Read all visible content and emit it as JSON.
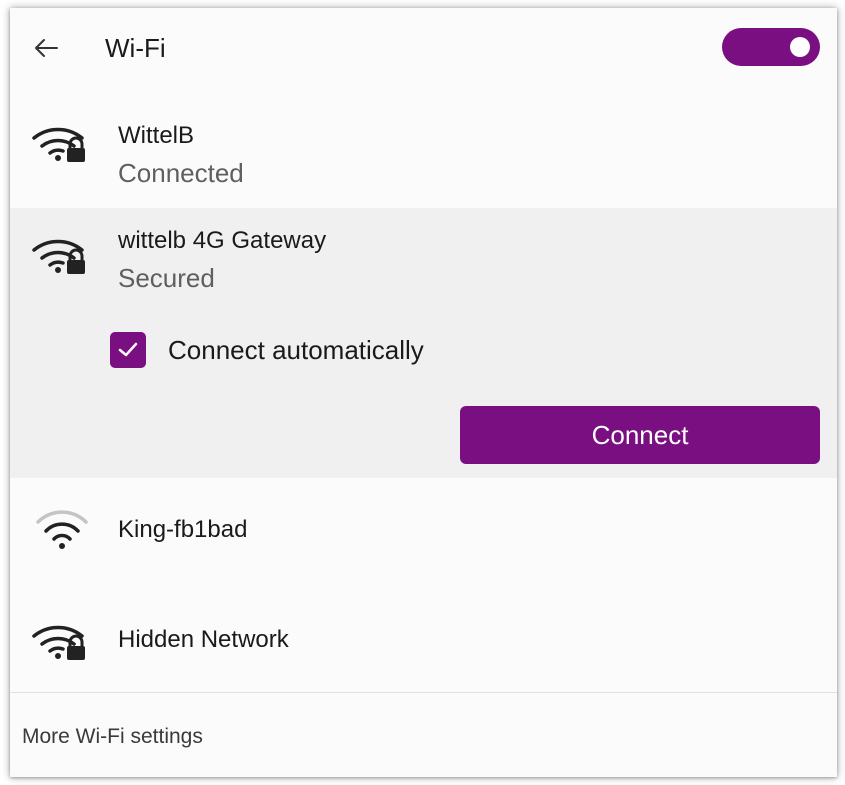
{
  "header": {
    "back_icon": "arrow-left-icon",
    "title": "Wi-Fi",
    "toggle_on": true
  },
  "networks": [
    {
      "name": "WittelB",
      "status": "Connected",
      "icon": "wifi-secured-icon",
      "signal": "full"
    },
    {
      "name": "wittelb 4G Gateway",
      "status": "Secured",
      "icon": "wifi-secured-icon",
      "signal": "full",
      "connect_automatically_label": "Connect automatically",
      "connect_automatically_checked": true,
      "connect_button": "Connect"
    },
    {
      "name": "King-fb1bad",
      "icon": "wifi-open-icon",
      "signal": "medium"
    },
    {
      "name": "Hidden Network",
      "icon": "wifi-secured-icon",
      "signal": "full"
    }
  ],
  "footer": {
    "more_settings": "More Wi-Fi settings"
  },
  "colors": {
    "accent": "#7a0f82",
    "panel_bg": "#fbfbfb",
    "selected_bg": "#f0f0f0",
    "secondary_text": "#5f5f5f"
  }
}
